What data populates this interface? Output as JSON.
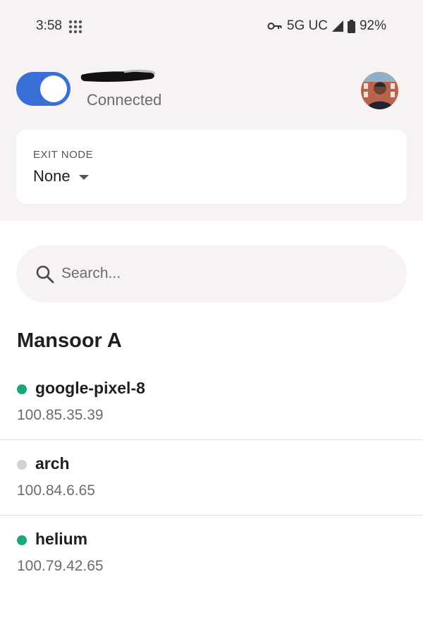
{
  "status_bar": {
    "time": "3:58",
    "network_label": "5G UC",
    "battery": "92%"
  },
  "header": {
    "vpn_toggle_on": true,
    "status": "Connected",
    "network_name_redacted": true
  },
  "exit_node": {
    "label": "EXIT NODE",
    "value": "None"
  },
  "search": {
    "placeholder": "Search...",
    "value": ""
  },
  "owner": "Mansoor A",
  "devices": [
    {
      "name": "google-pixel-8",
      "ip": "100.85.35.39",
      "online": true
    },
    {
      "name": "arch",
      "ip": "100.84.6.65",
      "online": false
    },
    {
      "name": "helium",
      "ip": "100.79.42.65",
      "online": true
    }
  ],
  "colors": {
    "accent": "#3b6fd8",
    "online": "#1aa873",
    "offline": "#d4d2d1",
    "header_bg": "#f6f3f2"
  }
}
